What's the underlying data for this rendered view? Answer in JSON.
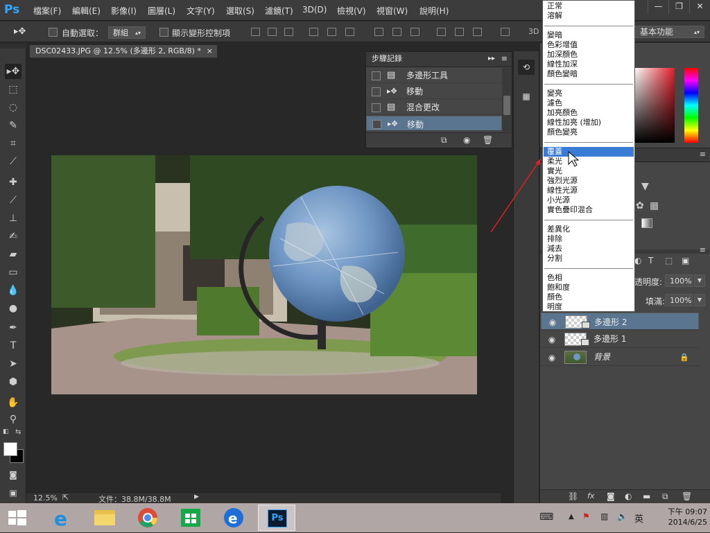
{
  "app": {
    "name": "Ps"
  },
  "menubar": {
    "items": [
      "檔案(F)",
      "編輯(E)",
      "影像(I)",
      "圖層(L)",
      "文字(Y)",
      "選取(S)",
      "濾鏡(T)",
      "3D(D)",
      "檢視(V)",
      "視窗(W)",
      "說明(H)"
    ]
  },
  "window_controls": {
    "minimize": "—",
    "restore": "❐",
    "close": "✕"
  },
  "options": {
    "auto_select_label": "自動選取：",
    "auto_select_value": "群組",
    "show_transform_label": "顯示變形控制項",
    "mode_3d": "3D",
    "workspace": "基本功能"
  },
  "document": {
    "tab_title": "DSC02433.JPG @ 12.5% (多邊形 2, RGB/8) *",
    "close": "×",
    "zoom": "12.5%",
    "file_info": "文件：38.8M/38.8M"
  },
  "history": {
    "title": "步驟記錄",
    "rows": [
      {
        "label": "多邊形工具",
        "icon": "document-icon"
      },
      {
        "label": "移動",
        "icon": "move-icon"
      },
      {
        "label": "混合更改",
        "icon": "document-icon"
      },
      {
        "label": "移動",
        "icon": "move-icon"
      }
    ]
  },
  "blend_menu": {
    "groups": [
      [
        "正常",
        "溶解"
      ],
      [
        "變暗",
        "色彩增值",
        "加深顏色",
        "線性加深",
        "顏色變暗"
      ],
      [
        "變亮",
        "濾色",
        "加亮顏色",
        "線性加亮 (增加)",
        "顏色變亮"
      ],
      [
        "覆蓋",
        "柔光",
        "實光",
        "強烈光源",
        "線性光源",
        "小光源",
        "實色疊印混合"
      ],
      [
        "差異化",
        "排除",
        "減去",
        "分割"
      ],
      [
        "色相",
        "飽和度",
        "顏色",
        "明度"
      ]
    ],
    "highlighted": "覆蓋"
  },
  "layers": {
    "opacity_label": "透明度:",
    "opacity_value": "100%",
    "fill_label": "填滿:",
    "fill_value": "100%",
    "rows": [
      {
        "name": "多邊形 2",
        "type": "shape"
      },
      {
        "name": "多邊形 1",
        "type": "shape"
      },
      {
        "name": "背景",
        "type": "background"
      }
    ]
  },
  "taskbar": {
    "ime": "英",
    "time": "下午 09:07",
    "date": "2014/6/25",
    "ps_label": "Ps"
  },
  "colors": {
    "ps_blue": "#31a8ff",
    "selection_blue": "#5a7590",
    "menu_highlight": "#3a7bd5",
    "arrow_red": "#e02020"
  }
}
